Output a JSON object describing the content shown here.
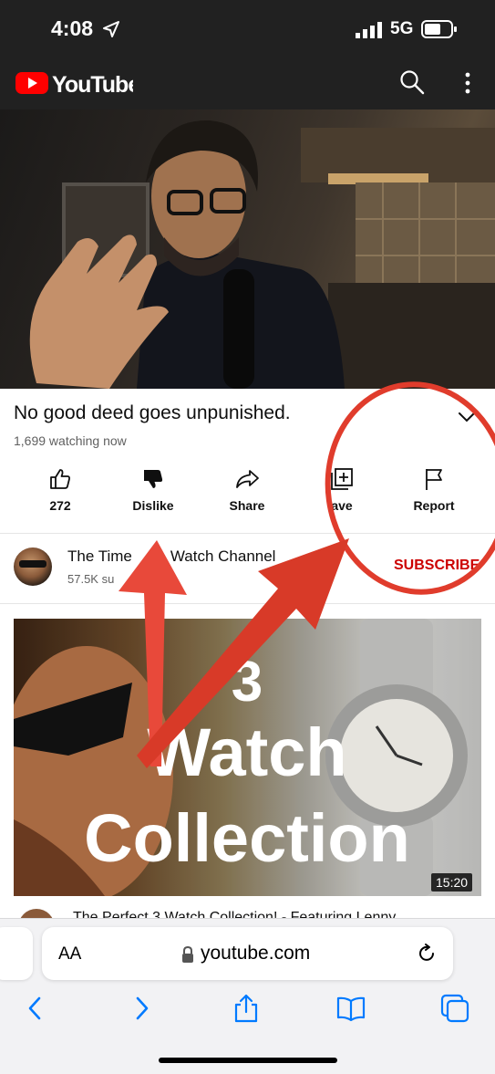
{
  "status_bar": {
    "time": "4:08",
    "network": "5G",
    "icons": [
      "location-arrow-icon",
      "signal-icon",
      "battery-icon"
    ]
  },
  "header": {
    "brand": "YouTube",
    "icons": [
      "youtube-logo",
      "search-icon",
      "more-vert-icon"
    ]
  },
  "video": {
    "title": "No good deed goes unpunished.",
    "watching": "1,699 watching now",
    "actions": [
      {
        "label": "272",
        "icon": "thumbs-up-icon"
      },
      {
        "label": "Dislike",
        "icon": "thumbs-down-icon"
      },
      {
        "label": "Share",
        "icon": "share-icon"
      },
      {
        "label": "ave",
        "icon": "save-playlist-icon"
      },
      {
        "label": "Report",
        "icon": "flag-icon"
      }
    ]
  },
  "channel": {
    "name": "The Time",
    "name_tail": "Watch Channel",
    "subs": "57.5K su",
    "subscribe": "SUBSCRIBE"
  },
  "recommended": {
    "thumb_text_line1": "3",
    "thumb_text_line2": "Watch",
    "thumb_text_line3": "Collection",
    "duration": "15:20",
    "next_title": "The Perfect 3 Watch Collection! - Featuring Lenny"
  },
  "safari": {
    "aa": "AA",
    "url": "youtube.com",
    "toolbar_icons": [
      "back-icon",
      "forward-icon",
      "share-icon",
      "bookmarks-icon",
      "tabs-icon"
    ]
  },
  "colors": {
    "youtube_red": "#ff0000",
    "subscribe_red": "#cc0000",
    "annotation_red": "#e03c2c",
    "safari_blue": "#007aff"
  }
}
